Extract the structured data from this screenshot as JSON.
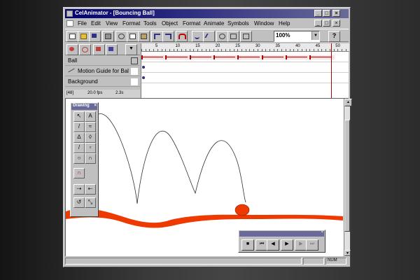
{
  "app": {
    "title": "CelAnimator - [Bouncing Ball]",
    "window_controls": [
      "minimize",
      "maximize",
      "close"
    ]
  },
  "menu": {
    "items": [
      {
        "label": "File"
      },
      {
        "label": "Edit"
      },
      {
        "label": "View"
      },
      {
        "label": "Format"
      },
      {
        "label": "Tools"
      },
      {
        "label": "Object"
      },
      {
        "label": "Format"
      },
      {
        "label": "Animate"
      },
      {
        "label": "Symbols"
      },
      {
        "label": "Window"
      },
      {
        "label": "Help"
      }
    ]
  },
  "toolbar": {
    "buttons": [
      "new-icon",
      "open-icon",
      "save-icon",
      "print-icon",
      "cut-icon",
      "copy-icon",
      "paste-icon",
      "undo-icon",
      "redo-icon",
      "magnet-icon",
      "smooth-icon",
      "straighten-icon",
      "rotate-icon",
      "scale-icon",
      "zoom-in-icon"
    ],
    "zoom_value": "100%",
    "help_label": "?"
  },
  "timeline": {
    "ruler_labels": [
      "5",
      "10",
      "15",
      "20",
      "25",
      "30",
      "35",
      "40",
      "45",
      "50"
    ],
    "layers": [
      {
        "name": "Ball"
      },
      {
        "name": "Motion Guide for Bal"
      },
      {
        "name": "Background"
      }
    ],
    "status": {
      "frame": "[48]",
      "fps": "20.0 fps",
      "time": "2.3s"
    },
    "keyframe_color": "#b00000",
    "playhead_frame": 48
  },
  "drawing_palette": {
    "title": "Drawing"
  },
  "controller": {
    "buttons": [
      "stop-icon",
      "rewind-icon",
      "step-back-icon",
      "play-icon",
      "step-forward-icon",
      "fast-forward-icon"
    ]
  },
  "statusbar": {
    "num": "NUM"
  },
  "colors": {
    "ball": "#ee3a00",
    "ground": "#ee3a00",
    "titlebar": "#00006e"
  }
}
